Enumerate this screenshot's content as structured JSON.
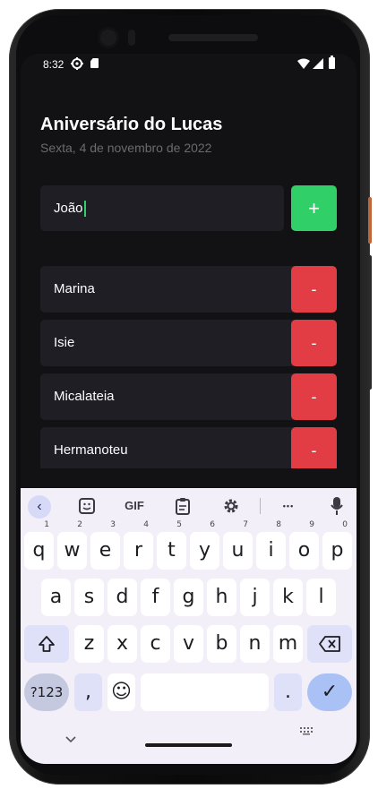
{
  "status_bar": {
    "time": "8:32",
    "icons": [
      "gear-icon",
      "sim-card-icon",
      "wifi-icon",
      "signal-icon",
      "battery-icon"
    ]
  },
  "app": {
    "title": "Aniversário do Lucas",
    "date": "Sexta, 4 de novembro de 2022",
    "input": {
      "value": "João"
    },
    "add_label": "+",
    "participants": [
      {
        "name": "Marina",
        "remove_label": "-"
      },
      {
        "name": "Isie",
        "remove_label": "-"
      },
      {
        "name": "Micalateia",
        "remove_label": "-"
      },
      {
        "name": "Hermanoteu",
        "remove_label": "-"
      }
    ],
    "colors": {
      "background": "#121214",
      "card": "#1f1e25",
      "add": "#31cf67",
      "remove": "#e23c44",
      "subtitle": "#6b6b6b"
    }
  },
  "keyboard": {
    "toolbar": {
      "back": "‹",
      "gif": "GIF",
      "more": "•••"
    },
    "row1": [
      {
        "k": "q",
        "n": "1"
      },
      {
        "k": "w",
        "n": "2"
      },
      {
        "k": "e",
        "n": "3"
      },
      {
        "k": "r",
        "n": "4"
      },
      {
        "k": "t",
        "n": "5"
      },
      {
        "k": "y",
        "n": "6"
      },
      {
        "k": "u",
        "n": "7"
      },
      {
        "k": "i",
        "n": "8"
      },
      {
        "k": "o",
        "n": "9"
      },
      {
        "k": "p",
        "n": "0"
      }
    ],
    "row2": [
      "a",
      "s",
      "d",
      "f",
      "g",
      "h",
      "j",
      "k",
      "l"
    ],
    "row3": [
      "z",
      "x",
      "c",
      "v",
      "b",
      "n",
      "m"
    ],
    "row4": {
      "symbols": "?123",
      "comma": ",",
      "emoji": "☺",
      "period": ".",
      "enter": "✓"
    }
  }
}
